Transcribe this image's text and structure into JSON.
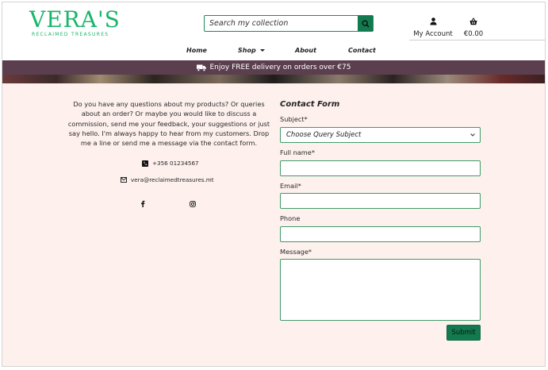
{
  "brand": {
    "logo_main": "VERA'S",
    "logo_sub": "RECLAIMED TREASURES",
    "color": "#18b56a"
  },
  "search": {
    "placeholder": "Search my collection",
    "icon": "search-icon"
  },
  "header": {
    "account_label": "My Account",
    "account_icon": "user-icon",
    "cart_total": "€0.00",
    "cart_icon": "basket-icon"
  },
  "nav": {
    "items": [
      {
        "label": "Home"
      },
      {
        "label": "Shop",
        "has_dropdown": true
      },
      {
        "label": "About"
      },
      {
        "label": "Contact"
      }
    ]
  },
  "banner": {
    "text": "Enjoy FREE delivery on orders over €75",
    "icon": "truck-icon",
    "color": "#5b3f4f"
  },
  "contact_info": {
    "intro": "Do you have any questions about my products? Or queries about an order? Or maybe you would like to discuss a commission, send me your feedback, your suggestions or just say hello. I'm always happy to hear from my customers. Drop me a line or send me a message via the contact form.",
    "phone": "+356 01234567",
    "phone_icon": "phone-icon",
    "email": "vera@reclaimedtreasures.mt",
    "email_icon": "envelope-icon",
    "social": [
      {
        "icon": "facebook-icon"
      },
      {
        "icon": "instagram-icon"
      }
    ]
  },
  "form": {
    "title": "Contact Form",
    "subject_label": "Subject*",
    "subject_value": "Choose Query Subject",
    "fullname_label": "Full name*",
    "email_label": "Email*",
    "phone_label": "Phone",
    "message_label": "Message*",
    "submit_label": "Submit",
    "accent": "#127a4e"
  }
}
